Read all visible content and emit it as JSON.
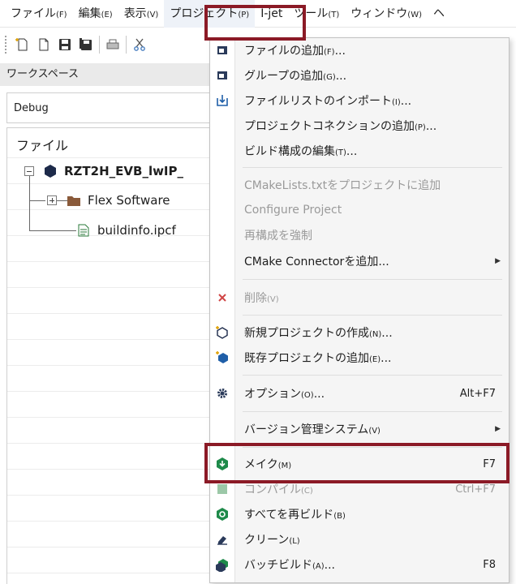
{
  "menubar": {
    "items": [
      {
        "label": "ファイル",
        "key": "(F)"
      },
      {
        "label": "編集",
        "key": "(E)"
      },
      {
        "label": "表示",
        "key": "(V)"
      },
      {
        "label": "プロジェクト",
        "key": "(P)"
      },
      {
        "label": "I-jet",
        "key": ""
      },
      {
        "label": "ツール",
        "key": "(T)"
      },
      {
        "label": "ウィンドウ",
        "key": "(W)"
      },
      {
        "label": "ヘ",
        "key": ""
      }
    ]
  },
  "workspace": {
    "title": "ワークスペース",
    "configuration": "Debug",
    "column_header": "ファイル",
    "tree": {
      "project": "RZT2H_EVB_lwIP_",
      "folder": "Flex Software",
      "file": "buildinfo.ipcf"
    }
  },
  "project_menu": {
    "items": {
      "add_files": {
        "label": "ファイルの追加",
        "key": "(F)",
        "suffix": "..."
      },
      "add_group": {
        "label": "グループの追加",
        "key": "(G)",
        "suffix": "..."
      },
      "import_file_list": {
        "label": "ファイルリストのインポート",
        "key": "(I)",
        "suffix": "..."
      },
      "add_project_connection": {
        "label": "プロジェクトコネクションの追加",
        "key": "(P)",
        "suffix": "..."
      },
      "edit_build_config": {
        "label": "ビルド構成の編集",
        "key": "(T)",
        "suffix": "..."
      },
      "add_cmakelists": {
        "label": "CMakeLists.txtをプロジェクトに追加",
        "key": "",
        "suffix": ""
      },
      "configure_project": {
        "label": "Configure Project",
        "key": "",
        "suffix": ""
      },
      "force_reconfigure": {
        "label": "再構成を強制",
        "key": "",
        "suffix": ""
      },
      "add_cmake_connector": {
        "label": "CMake Connectorを追加",
        "key": "",
        "suffix": "..."
      },
      "delete": {
        "label": "削除",
        "key": "(V)",
        "suffix": ""
      },
      "create_new_project": {
        "label": "新規プロジェクトの作成",
        "key": "(N)",
        "suffix": "..."
      },
      "add_existing_project": {
        "label": "既存プロジェクトの追加",
        "key": "(E)",
        "suffix": "..."
      },
      "options": {
        "label": "オプション",
        "key": "(O)",
        "suffix": "...",
        "shortcut": "Alt+F7"
      },
      "version_control": {
        "label": "バージョン管理システム",
        "key": "(V)",
        "suffix": ""
      },
      "make": {
        "label": "メイク",
        "key": "(M)",
        "suffix": "",
        "shortcut": "F7"
      },
      "compile": {
        "label": "コンパイル",
        "key": "(C)",
        "suffix": "",
        "shortcut": "Ctrl+F7"
      },
      "rebuild_all": {
        "label": "すべてを再ビルド",
        "key": "(B)",
        "suffix": ""
      },
      "clean": {
        "label": "クリーン",
        "key": "(L)",
        "suffix": ""
      },
      "batch_build": {
        "label": "バッチビルド",
        "key": "(A)",
        "suffix": "...",
        "shortcut": "F8"
      }
    }
  },
  "colors": {
    "highlight_border": "#8b1a26",
    "green_icon": "#1e8a4a",
    "blue_icon": "#1f5fa8",
    "folder": "#8a5a3a",
    "delete_x": "#d04444"
  }
}
